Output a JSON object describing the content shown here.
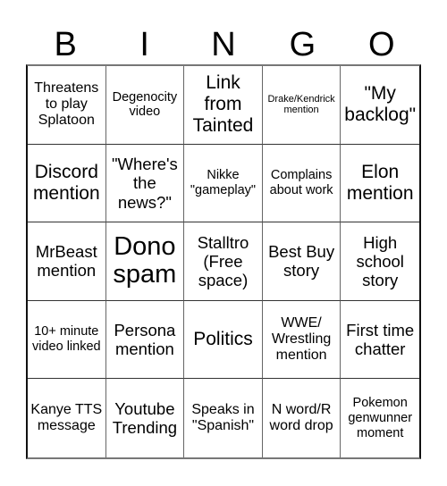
{
  "header": {
    "letters": [
      "B",
      "I",
      "N",
      "G",
      "O"
    ]
  },
  "cells": [
    "Threatens to play Splatoon",
    "Degenocity video",
    "Link from Tainted",
    "Drake/Kendrick mention",
    "\"My backlog\"",
    "Discord mention",
    "\"Where's the news?\"",
    "Nikke \"gameplay\"",
    "Complains about work",
    "Elon mention",
    "MrBeast mention",
    "Dono spam",
    "Stalltro (Free space)",
    "Best Buy story",
    "High school story",
    "10+ minute video linked",
    "Persona mention",
    "Politics",
    "WWE/ Wrestling mention",
    "First time chatter",
    "Kanye TTS message",
    "Youtube Trending",
    "Speaks in \"Spanish\"",
    "N word/R word drop",
    "Pokemon genwunner moment"
  ]
}
